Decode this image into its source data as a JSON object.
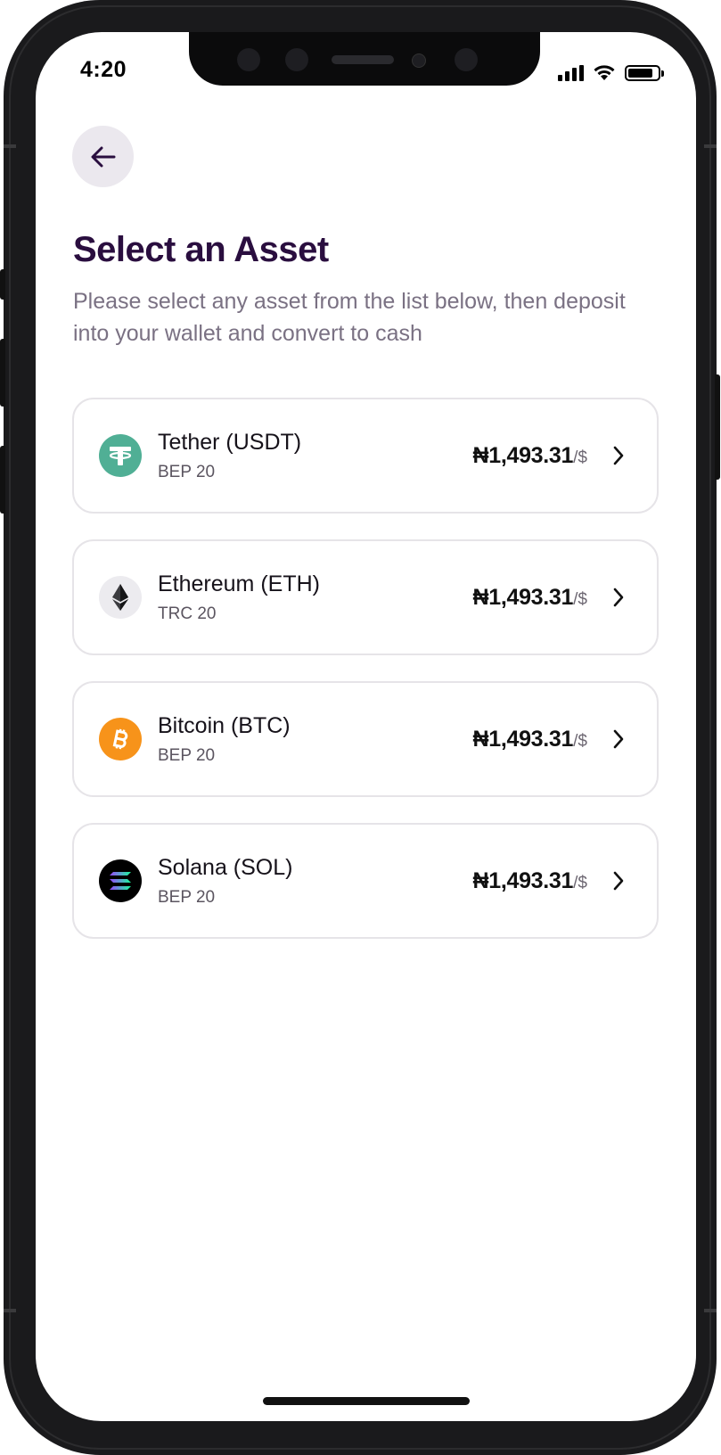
{
  "status": {
    "time": "4:20"
  },
  "header": {
    "title": "Select an Asset",
    "subtitle": "Please select any asset from the list below, then deposit into your wallet and convert to cash"
  },
  "assets": [
    {
      "name": "Tether (USDT)",
      "network": "BEP 20",
      "price": "₦1,493.31",
      "unit": "/$",
      "icon": "tether-icon",
      "color": "#50af95"
    },
    {
      "name": "Ethereum (ETH)",
      "network": "TRC 20",
      "price": "₦1,493.31",
      "unit": "/$",
      "icon": "ethereum-icon",
      "color": "#ecebef"
    },
    {
      "name": "Bitcoin (BTC)",
      "network": "BEP 20",
      "price": "₦1,493.31",
      "unit": "/$",
      "icon": "bitcoin-icon",
      "color": "#f7931a"
    },
    {
      "name": "Solana (SOL)",
      "network": "BEP 20",
      "price": "₦1,493.31",
      "unit": "/$",
      "icon": "solana-icon",
      "color": "#000000"
    }
  ],
  "colors": {
    "title": "#2a0e3f",
    "subtitle": "#7a7183",
    "back_button_bg": "#ebe8ee",
    "card_border": "#e6e4e8"
  },
  "battery": {
    "level": 0.85
  }
}
